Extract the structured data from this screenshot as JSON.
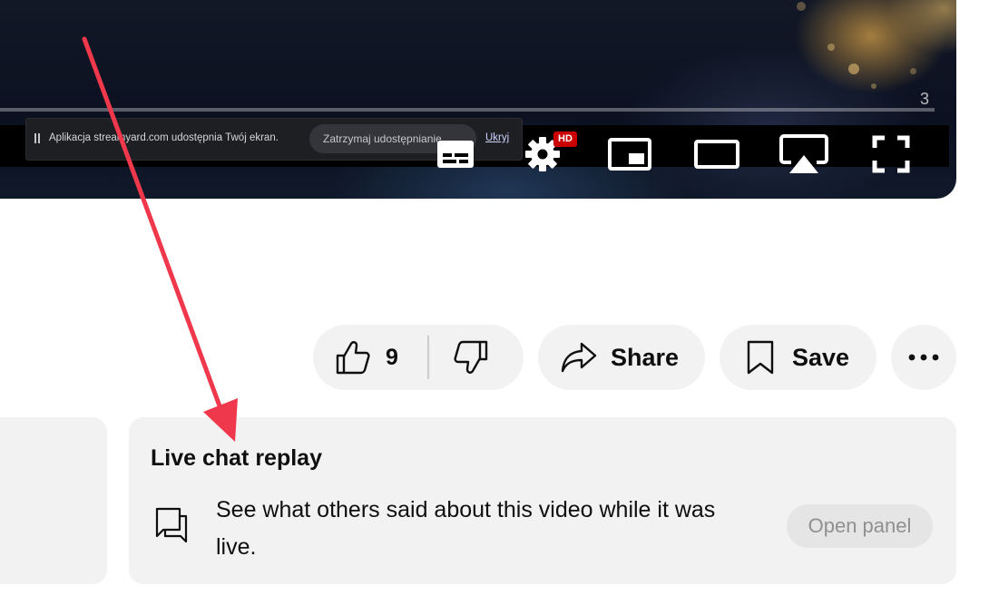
{
  "player": {
    "time_fragment": "3",
    "share_banner": {
      "text": "Aplikacja streamyard.com udostępnia Twój ekran.",
      "stop_label": "Zatrzymaj udostępnianie",
      "hide_label": "Ukryj"
    },
    "controls": {
      "hd_badge": "HD",
      "icons": [
        "subtitles-icon",
        "settings-gear-icon",
        "miniplayer-icon",
        "theater-mode-icon",
        "airplay-icon",
        "fullscreen-icon"
      ]
    }
  },
  "actions": {
    "like_count": "9",
    "share_label": "Share",
    "save_label": "Save"
  },
  "live_chat": {
    "title": "Live chat replay",
    "description": "See what others said about this video while it was live.",
    "open_panel_label": "Open panel"
  },
  "colors": {
    "annotation_arrow": "#f0384d",
    "hd_badge": "#cc0000",
    "pill_background": "#f2f2f2"
  }
}
